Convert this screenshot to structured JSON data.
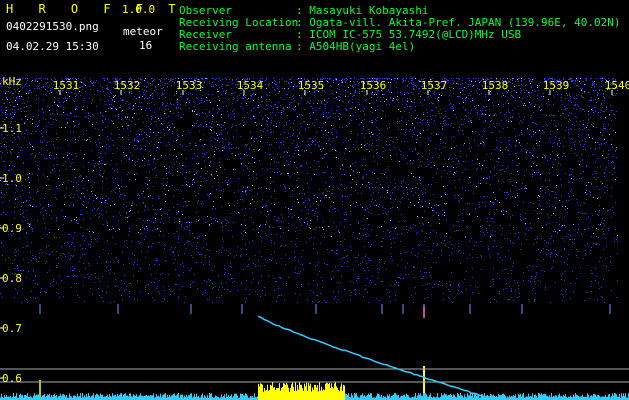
{
  "header": {
    "app_name": "H R O F F T",
    "version": "1.0.0",
    "filename": "0402291530.png",
    "datetime": "04.02.29 15:30",
    "mode_label": "meteor",
    "count": "16"
  },
  "station": {
    "rows": [
      {
        "label": "Observer",
        "value": ": Masayuki Kobayashi"
      },
      {
        "label": "Receiving Location",
        "value": ": Ogata-vill. Akita-Pref. JAPAN (139.96E, 40.02N)"
      },
      {
        "label": "Receiver",
        "value": ": ICOM IC-575 53.7492(@LCD)MHz USB"
      },
      {
        "label": "Receiving antenna",
        "value": ": A504HB(yagi 4el)"
      }
    ]
  },
  "axis": {
    "unit": "kHz",
    "time_ticks": [
      "1531",
      "1532",
      "1533",
      "1534",
      "1535",
      "1536",
      "1537",
      "1538",
      "1539",
      "1540"
    ],
    "freq_ticks": [
      "1.1",
      "1.0",
      "0.9",
      "0.8",
      "0.7",
      "0.6"
    ]
  },
  "colors": {
    "background": "#000000",
    "text_yellow": "#ffff00",
    "text_green": "#00ff33",
    "text_white": "#ffffff",
    "trail": "#33ccff",
    "noise": "#3333ff",
    "spike": "#ffff00"
  }
}
